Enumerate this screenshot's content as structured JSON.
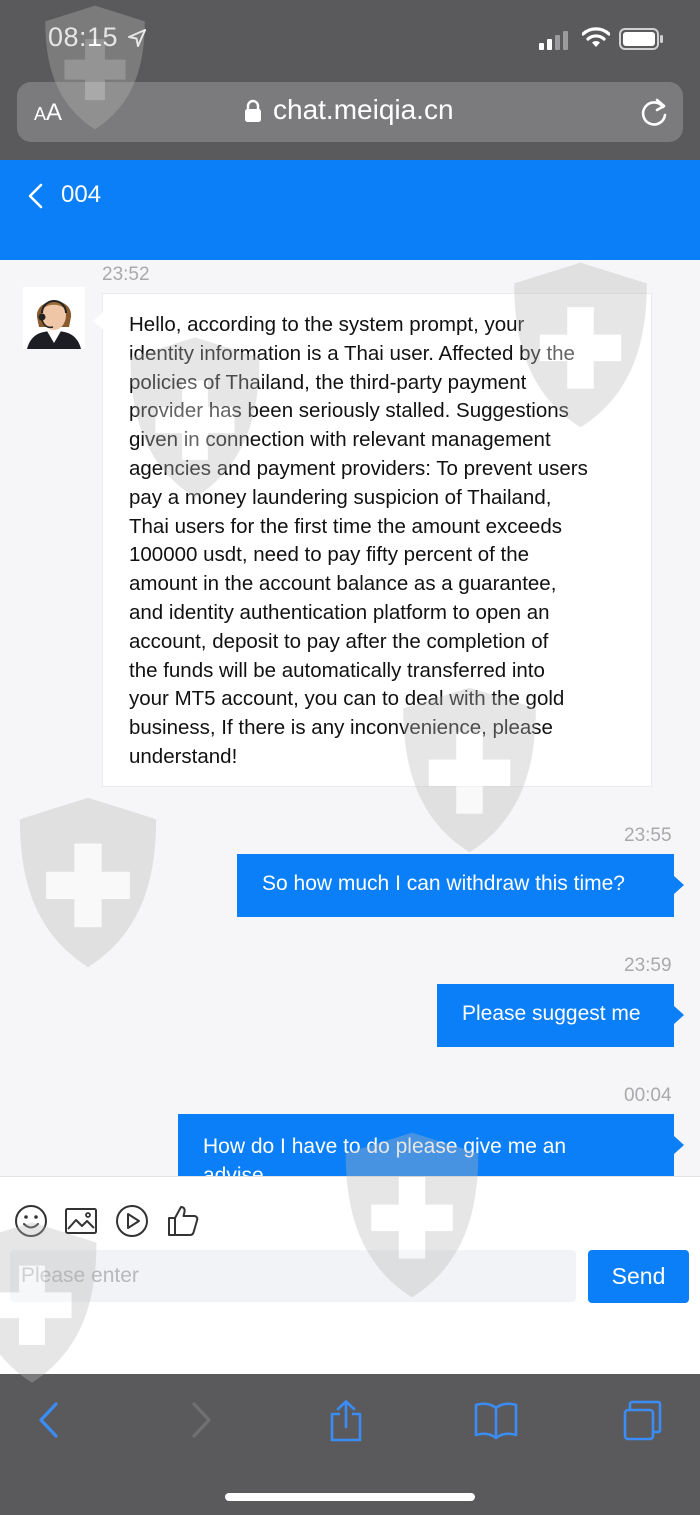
{
  "status_bar": {
    "time": "08:15"
  },
  "browser": {
    "aa_small": "A",
    "aa_large": "A",
    "url": "chat.meiqia.cn"
  },
  "chat_header": {
    "title": "004"
  },
  "messages": [
    {
      "sender": "agent",
      "timestamp": "23:52",
      "text": "Hello, according to the system prompt, your\nidentity information is a Thai user. Affected by the\npolicies of Thailand, the third-party payment\nprovider has been seriously stalled. Suggestions\ngiven in connection with relevant management\nagencies and payment providers: To prevent users\npay a money laundering suspicion of Thailand,\nThai users for the first time the amount exceeds\n100000 usdt, need to pay fifty percent of the\namount in the account balance as a guarantee,\nand identity authentication platform to open an\naccount, deposit to pay after the completion of\nthe funds will be automatically transferred into\nyour MT5 account, you can to deal with the gold\nbusiness, If there is any inconvenience, please\nunderstand!"
    },
    {
      "sender": "user",
      "timestamp": "23:55",
      "text": "So how much I can withdraw this time?"
    },
    {
      "sender": "user",
      "timestamp": "23:59",
      "text": "Please suggest me"
    },
    {
      "sender": "user",
      "timestamp": "00:04",
      "text": "How do I have to do please give me an advise"
    }
  ],
  "composer": {
    "placeholder": "Please enter",
    "send_label": "Send"
  },
  "icons": [
    "location-arrow-icon",
    "signal-icon",
    "wifi-icon",
    "battery-icon",
    "lock-icon",
    "reload-icon",
    "back-chevron-icon",
    "emoji-icon",
    "image-icon",
    "video-icon",
    "thumbs-up-icon",
    "nav-back-icon",
    "nav-forward-icon",
    "share-icon",
    "bookmarks-icon",
    "tabs-icon"
  ],
  "colors": {
    "accent": "#0a7ff8",
    "chrome": "#5a5a5c",
    "chat_bg": "#f6f6f8",
    "ios_icon_blue": "#3b8cf5"
  }
}
